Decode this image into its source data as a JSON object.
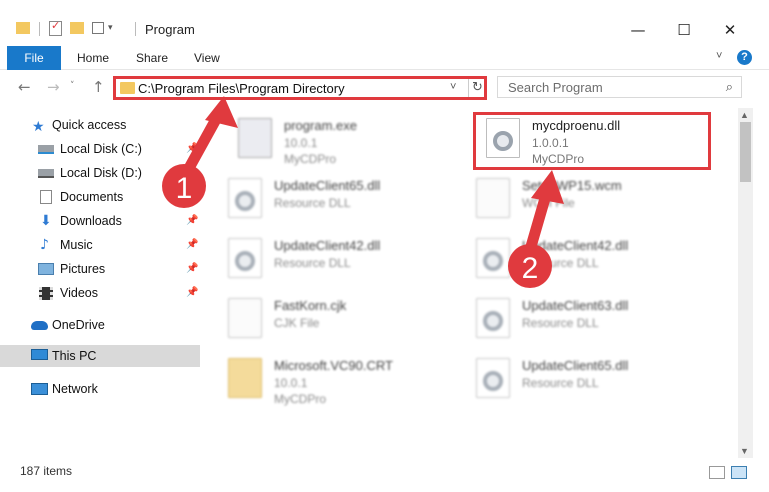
{
  "window": {
    "title": "Program",
    "minimize": "—",
    "maximize": "☐",
    "close": "✕"
  },
  "ribbon": {
    "tabs": [
      "File",
      "Home",
      "Share",
      "View"
    ],
    "help": "?"
  },
  "address": {
    "path": "C:\\Program Files\\Program Directory",
    "search_placeholder": "Search Program"
  },
  "sidebar": {
    "items": [
      {
        "label": "Quick access",
        "icon": "star-icon"
      },
      {
        "label": "Local Disk (C:)",
        "icon": "drive-icon",
        "pinned": true
      },
      {
        "label": "Local Disk (D:)",
        "icon": "drive-icon"
      },
      {
        "label": "Documents",
        "icon": "documents-icon",
        "pinned": true
      },
      {
        "label": "Downloads",
        "icon": "download-icon",
        "pinned": true
      },
      {
        "label": "Music",
        "icon": "music-icon",
        "pinned": true
      },
      {
        "label": "Pictures",
        "icon": "pictures-icon",
        "pinned": true
      },
      {
        "label": "Videos",
        "icon": "videos-icon",
        "pinned": true
      },
      {
        "label": "OneDrive",
        "icon": "cloud-icon"
      },
      {
        "label": "This PC",
        "icon": "computer-icon",
        "selected": true
      },
      {
        "label": "Network",
        "icon": "network-icon"
      }
    ]
  },
  "files": [
    {
      "name": "program.exe",
      "line1": "10.0.1",
      "line2": "MyCDPro",
      "icon": "exe"
    },
    {
      "name": "mycdproenu.dll",
      "line1": "1.0.0.1",
      "line2": "MyCDPro",
      "icon": "dll",
      "highlight": true
    },
    {
      "name": "UpdateClient65.dll",
      "line1": "Resource DLL",
      "line2": "",
      "icon": "dll"
    },
    {
      "name": "SetupWP15.wcm",
      "line1": "WCM File",
      "line2": "",
      "icon": "plain"
    },
    {
      "name": "UpdateClient42.dll",
      "line1": "Resource DLL",
      "line2": "",
      "icon": "dll"
    },
    {
      "name": "UpdateClient42.dll",
      "line1": "Resource DLL",
      "line2": "",
      "icon": "dll"
    },
    {
      "name": "FastKorn.cjk",
      "line1": "CJK File",
      "line2": "",
      "icon": "plain"
    },
    {
      "name": "UpdateClient63.dll",
      "line1": "Resource DLL",
      "line2": "",
      "icon": "dll"
    },
    {
      "name": "Microsoft.VC90.CRT",
      "line1": "10.0.1",
      "line2": "MyCDPro",
      "icon": "folder"
    },
    {
      "name": "UpdateClient65.dll",
      "line1": "Resource DLL",
      "line2": "",
      "icon": "dll"
    }
  ],
  "status": {
    "item_count": "187 items"
  },
  "annotations": {
    "step1": "1",
    "step2": "2",
    "color": "#e03a3e"
  }
}
